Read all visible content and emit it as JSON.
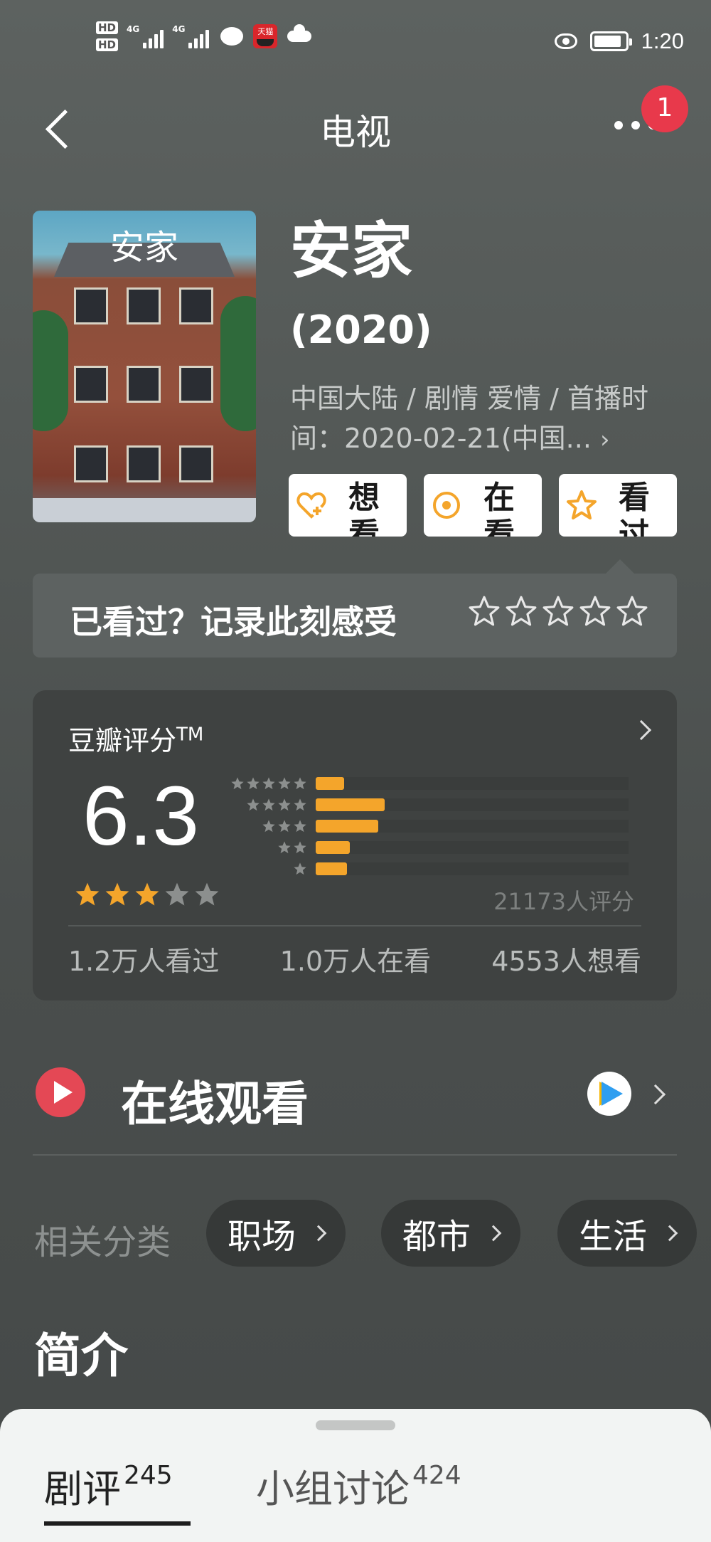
{
  "status_bar": {
    "time": "1:20",
    "hd1": "HD",
    "hd2": "HD",
    "net1": "4G",
    "net2": "4G",
    "app_badge": "天猫"
  },
  "nav": {
    "title": "电视",
    "notification_count": "1"
  },
  "movie": {
    "poster_title": "安家",
    "title": "安家",
    "year": "(2020)",
    "meta": "中国大陆 / 剧情 爱情 / 首播时间：2020-02-21(中国...",
    "meta_chevron": "›"
  },
  "actions": {
    "want": "想看",
    "watching": "在看",
    "watched": "看过"
  },
  "feel": {
    "prompt": "已看过？记录此刻感受"
  },
  "rating": {
    "title": "豆瓣评分",
    "tm": "TM",
    "score": "6.3",
    "stars_filled": 3,
    "stars_total": 5,
    "count": "21173人评分",
    "distribution": [
      {
        "stars": 5,
        "fraction": 0.09
      },
      {
        "stars": 4,
        "fraction": 0.22
      },
      {
        "stars": 3,
        "fraction": 0.2
      },
      {
        "stars": 2,
        "fraction": 0.11
      },
      {
        "stars": 1,
        "fraction": 0.1
      }
    ],
    "stats": {
      "watched": "1.2万人看过",
      "watching": "1.0万人在看",
      "want": "4553人想看"
    }
  },
  "watch": {
    "title": "在线观看"
  },
  "tags": {
    "label": "相关分类",
    "items": [
      "职场",
      "都市",
      "生活"
    ]
  },
  "intro": {
    "title": "简介"
  },
  "sheet": {
    "tab1_label": "剧评",
    "tab1_count": "245",
    "tab2_label": "小组讨论",
    "tab2_count": "424"
  },
  "colors": {
    "accent_orange": "#f4a52b",
    "badge_red": "#e8394b",
    "play_red": "#e44855",
    "tencent_blue": "#2f9ef0"
  }
}
